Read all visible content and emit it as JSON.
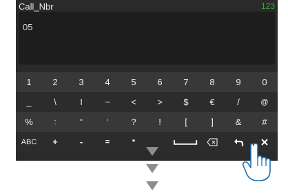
{
  "header": {
    "title": "Call_Nbr",
    "counter": "123"
  },
  "input": {
    "value": "05"
  },
  "keyboard": {
    "row1": [
      "1",
      "2",
      "3",
      "4",
      "5",
      "6",
      "7",
      "8",
      "9",
      "0"
    ],
    "row2": [
      "_",
      "\\",
      "I",
      "~",
      "<",
      ">",
      "$",
      "€",
      "/",
      "@"
    ],
    "row3": [
      "%",
      ":",
      "\"",
      "'",
      "?",
      "!",
      "[",
      "]",
      "&",
      "#"
    ],
    "row4": [
      "ABC",
      "+",
      "-",
      "=",
      "*"
    ],
    "icons": [
      "space-bar-icon",
      "backspace-icon",
      "return-icon",
      "close-icon"
    ]
  },
  "overlay": {
    "arrows": [
      "arrow-down-icon",
      "arrow-down-icon",
      "arrow-down-icon"
    ],
    "pointer": "hand-pointer-icon"
  }
}
